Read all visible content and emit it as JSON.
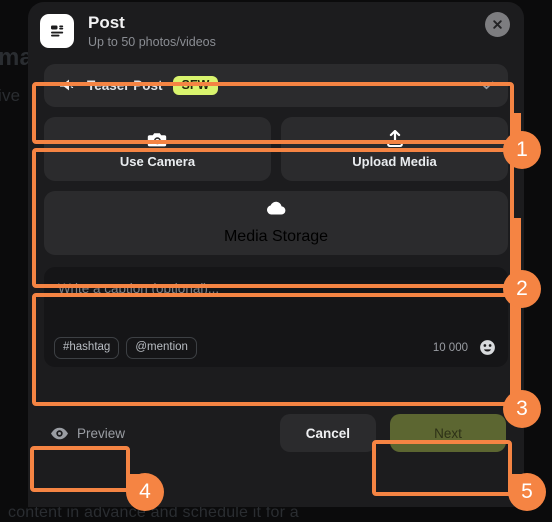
{
  "background": {
    "line1": "ma",
    "line2": "ive",
    "line3": "content in advance and schedule it for a"
  },
  "modal": {
    "header": {
      "icon": "post-article-icon",
      "title": "Post",
      "subtitle": "Up to 50 photos/videos",
      "close_icon": "close-icon"
    },
    "visibility": {
      "icon": "megaphone-icon",
      "label": "Teaser Post",
      "badge": "SFW",
      "badge_color": "#d9f46e",
      "chevron_icon": "chevron-down-icon"
    },
    "media": {
      "camera": {
        "icon": "camera-icon",
        "label": "Use Camera"
      },
      "upload": {
        "icon": "upload-icon",
        "label": "Upload Media"
      },
      "storage": {
        "icon": "cloud-icon",
        "label": "Media Storage"
      }
    },
    "caption": {
      "value": "",
      "placeholder": "Write a caption (optional)...",
      "chips": [
        {
          "label": "#hashtag"
        },
        {
          "label": "@mention"
        }
      ],
      "char_count": "10 000",
      "emoji_icon": "emoji-smiley-icon"
    },
    "footer": {
      "preview_icon": "eye-icon",
      "preview_label": "Preview",
      "cancel_label": "Cancel",
      "next_label": "Next",
      "next_color": "#5c6631"
    }
  },
  "annotations": {
    "accent_color": "#f58443",
    "markers": [
      {
        "number": "1"
      },
      {
        "number": "2"
      },
      {
        "number": "3"
      },
      {
        "number": "4"
      },
      {
        "number": "5"
      }
    ]
  }
}
